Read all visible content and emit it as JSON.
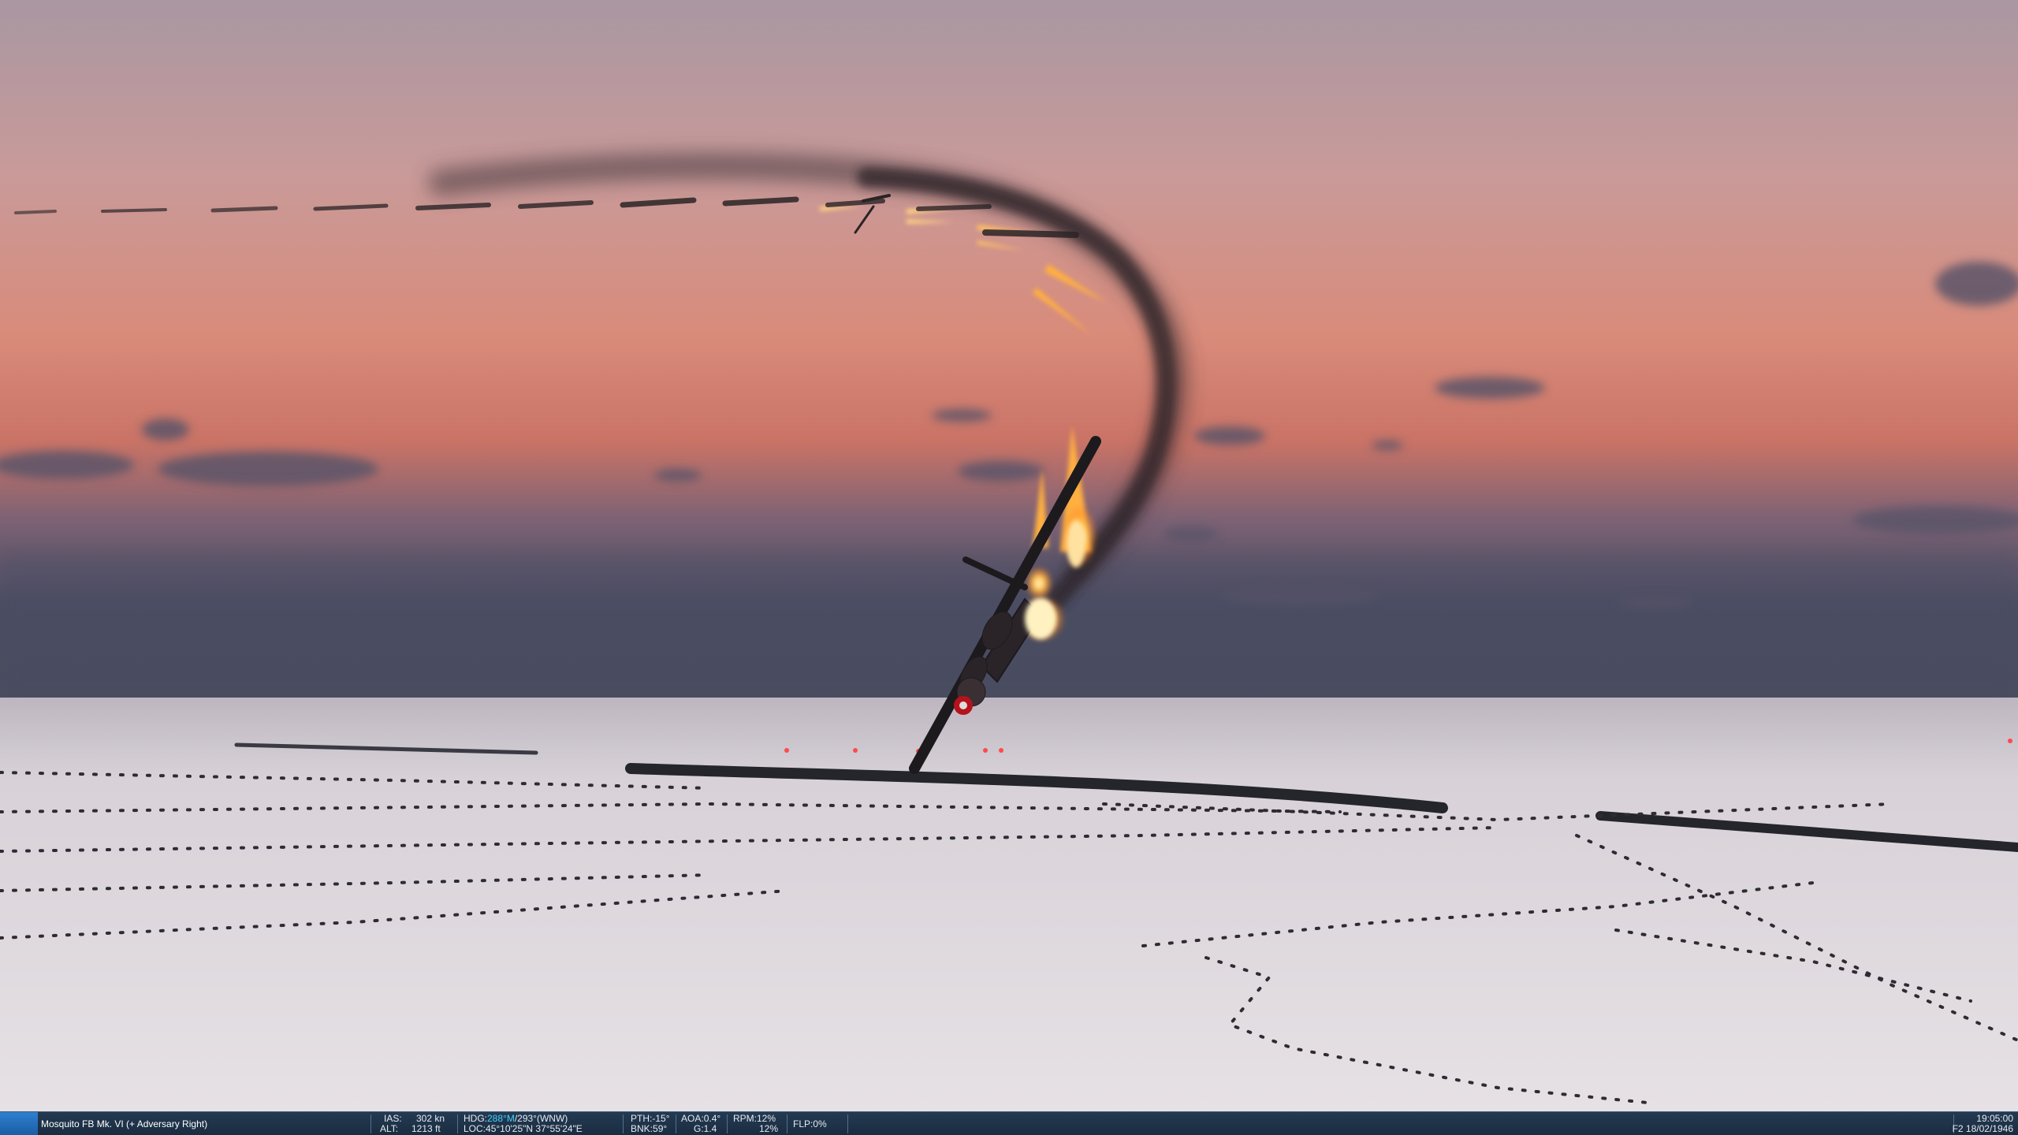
{
  "status_bar": {
    "aircraft": "Mosquito FB Mk. VI (+ Adversary Right)",
    "ias_label": "IAS:",
    "ias_value": "302 kn",
    "alt_label": "ALT:",
    "alt_value": "1213 ft",
    "hdg_label": "HDG:",
    "hdg_mag": "288°M",
    "hdg_true": "/293°(WNW)",
    "loc_label": "LOC:",
    "loc_value": "45°10'25\"N 37°55'24\"E",
    "pth_label": "PTH:",
    "pth_value": "-15°",
    "bnk_label": "BNK:",
    "bnk_value": "59°",
    "aoa_label": "AOA:",
    "aoa_value": "0.4°",
    "g_label": "G:",
    "g_value": "1.4",
    "rpm_label": "RPM:",
    "rpm_value1": "12%",
    "rpm_value2": "12%",
    "flp_label": "FLP:",
    "flp_value": "0%",
    "time": "19:05:00",
    "date": "F2 18/02/1946"
  },
  "colors": {
    "statusbar_bg": "#1e3248",
    "highlight": "#3fd3ff",
    "sky_top": "#b39aa0",
    "sky_horizon": "#d47b6c",
    "snow": "#e3dde1"
  }
}
